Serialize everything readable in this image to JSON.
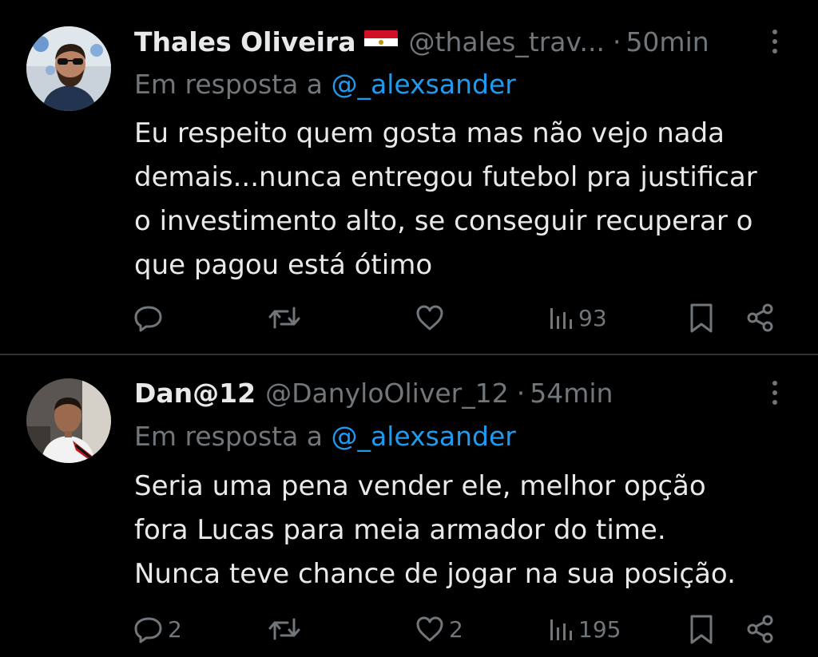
{
  "tweets": [
    {
      "display_name": "Thales Oliveira",
      "flag_icon": "egypt-flag-icon",
      "handle": "@thales_trav...",
      "dot": "·",
      "time": "50min",
      "reply_prefix": "Em resposta a ",
      "reply_mention": "@_alexsander",
      "text_lines": [
        "Eu respeito quem gosta mas não vejo nada",
        "demais...nunca entregou futebol pra justificar",
        "o investimento alto, se conseguir recuperar o",
        "que pagou está ótimo"
      ],
      "replies": "",
      "retweets": "",
      "likes": "",
      "views": "93"
    },
    {
      "display_name": "Dan@12",
      "handle": "@DanyloOliver_12",
      "dot": "·",
      "time": "54min",
      "reply_prefix": "Em resposta a ",
      "reply_mention": "@_alexsander",
      "text_lines": [
        "Seria uma pena vender ele, melhor opção",
        "fora Lucas para meia armador do time.",
        "Nunca teve chance de jogar na sua posição."
      ],
      "replies": "2",
      "retweets": "",
      "likes": "2",
      "views": "195"
    }
  ],
  "colors": {
    "background": "#000000",
    "text": "#e7e9ea",
    "muted": "#71767b",
    "link": "#1d9bf0",
    "divider": "#2f3336"
  },
  "icons": [
    "reply-icon",
    "retweet-icon",
    "like-icon",
    "views-icon",
    "bookmark-icon",
    "share-icon",
    "more-icon"
  ]
}
